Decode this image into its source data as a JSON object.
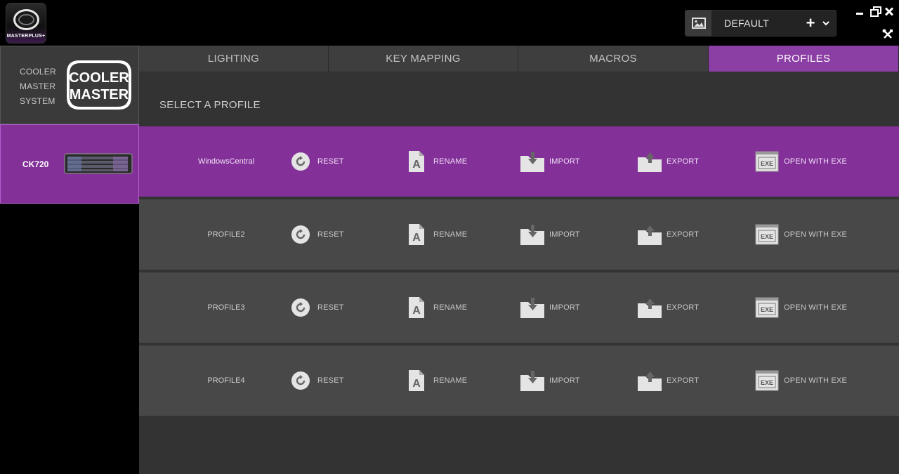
{
  "app": {
    "logo_text": "MASTERPLUS+"
  },
  "profile_selector": {
    "current": "DEFAULT",
    "add_label": "+",
    "dropdown_label": "⌄"
  },
  "sidebar": {
    "brand_lines": [
      "COOLER",
      "MASTER",
      "SYSTEM"
    ],
    "brand_logo_text": [
      "COOLER",
      "MASTER"
    ],
    "device": "CK720"
  },
  "tabs": [
    {
      "label": "LIGHTING",
      "active": false
    },
    {
      "label": "KEY MAPPING",
      "active": false
    },
    {
      "label": "MACROS",
      "active": false
    },
    {
      "label": "PROFILES",
      "active": true
    }
  ],
  "main": {
    "title": "SELECT A PROFILE",
    "actions": {
      "reset": "RESET",
      "rename": "RENAME",
      "import": "IMPORT",
      "export": "EXPORT",
      "exe": "OPEN WITH EXE",
      "exe_badge": "EXE"
    },
    "profiles": [
      {
        "name": "WindowsCentral",
        "active": true
      },
      {
        "name": "PROFILE2",
        "active": false
      },
      {
        "name": "PROFILE3",
        "active": false
      },
      {
        "name": "PROFILE4",
        "active": false
      }
    ]
  },
  "colors": {
    "accent": "#833099",
    "tab_active": "#8b3ea3",
    "row": "#484848",
    "main_bg": "#333333"
  }
}
